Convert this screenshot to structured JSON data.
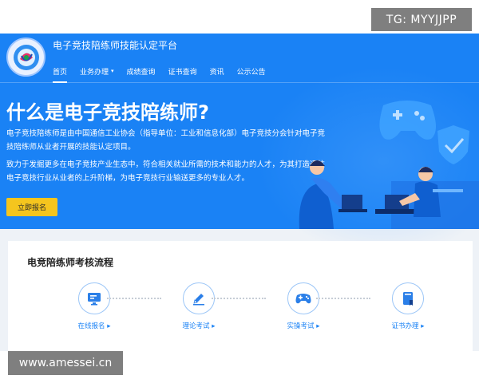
{
  "watermark_top": "TG: MYYJJPP",
  "watermark_bottom": "www.amessei.cn",
  "header": {
    "platform_title": "电子竞技陪练师技能认定平台",
    "nav": [
      {
        "label": "首页",
        "active": true
      },
      {
        "label": "业务办理",
        "dropdown": true,
        "caret": "▾"
      },
      {
        "label": "成绩查询"
      },
      {
        "label": "证书查询"
      },
      {
        "label": "资讯"
      },
      {
        "label": "公示公告"
      }
    ]
  },
  "hero": {
    "heading": "什么是电子竞技陪练师?",
    "paragraph1": "电子竞技陪练师是由中国通信工业协会（指导单位：工业和信息化部）电子竞技分会针对电子竞技陪练师从业者开展的技能认定项目。",
    "paragraph2": "致力于发掘更多在电子竞技产业生态中，符合相关就业所需的技术和能力的人才，为其打造通往电子竞技行业从业者的上升阶梯，为电子竞技行业输送更多的专业人才。",
    "cta_label": "立即报名"
  },
  "process": {
    "title": "电竞陪练师考核流程",
    "steps": [
      {
        "label": "在线报名 ▸",
        "icon": "monitor-icon"
      },
      {
        "label": "理论考试 ▸",
        "icon": "pen-icon"
      },
      {
        "label": "实操考试 ▸",
        "icon": "gamepad-icon"
      },
      {
        "label": "证书办理 ▸",
        "icon": "certificate-icon"
      }
    ]
  },
  "colors": {
    "brand_blue": "#1a82f5",
    "cta_yellow": "#f5c51e",
    "step_border": "#9cc6f7"
  }
}
